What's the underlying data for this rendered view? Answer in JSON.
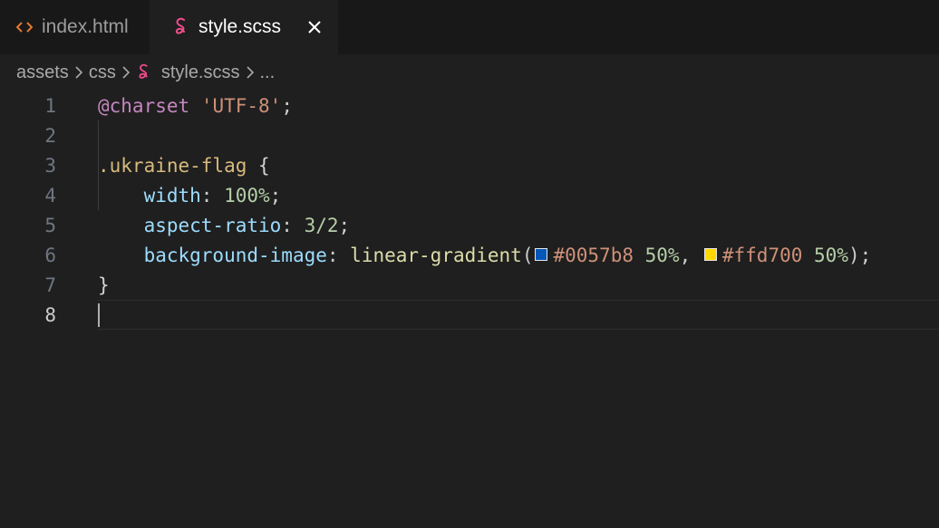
{
  "tabs": [
    {
      "label": "index.html",
      "icon": "html-code-icon",
      "active": false
    },
    {
      "label": "style.scss",
      "icon": "sass-icon",
      "active": true
    }
  ],
  "breadcrumb": {
    "folder1": "assets",
    "folder2": "css",
    "file": "style.scss",
    "more": "..."
  },
  "editor": {
    "current_line": 8,
    "lines": [
      {
        "n": "1",
        "tokens": {
          "at": "@charset",
          "sp": " ",
          "str": "'UTF-8'",
          "end": ";"
        }
      },
      {
        "n": "2"
      },
      {
        "n": "3",
        "tokens": {
          "sel": ".ukraine-flag",
          "open": " {"
        }
      },
      {
        "n": "4",
        "tokens": {
          "indent": "    ",
          "prop": "width",
          "colon": ": ",
          "val": "100%",
          "end": ";"
        }
      },
      {
        "n": "5",
        "tokens": {
          "indent": "    ",
          "prop": "aspect-ratio",
          "colon": ": ",
          "val": "3/2",
          "end": ";"
        }
      },
      {
        "n": "6",
        "tokens": {
          "indent": "    ",
          "prop": "background-image",
          "colon": ": ",
          "fn": "linear-gradient",
          "paren": "(",
          "hex1": "#0057b8",
          "pct1": " 50%",
          "comma": ", ",
          "hex2": "#ffd700",
          "pct2": " 50%",
          "close": ");"
        }
      },
      {
        "n": "7",
        "tokens": {
          "brace": "}"
        }
      },
      {
        "n": "8"
      }
    ],
    "swatch_colors": [
      "#0057b8",
      "#ffd700"
    ]
  },
  "colors": {
    "background": "#1f1f1f",
    "tabbar": "#181818",
    "sass_pink": "#f14c8c",
    "html_orange": "#e37933"
  }
}
